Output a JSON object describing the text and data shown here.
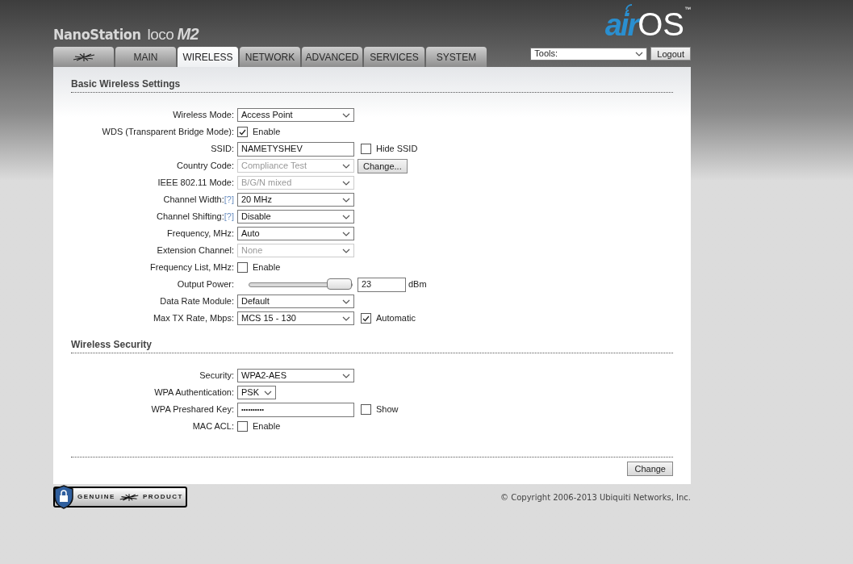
{
  "header": {
    "product_name": "NanoStation",
    "product_variant": "loco",
    "product_model": "M2",
    "logo_air": "air",
    "logo_os": "OS",
    "logo_tm": "™"
  },
  "tabs": [
    {
      "kind": "logo",
      "selected": false
    },
    {
      "kind": "text",
      "label": "MAIN",
      "selected": false
    },
    {
      "kind": "text",
      "label": "WIRELESS",
      "selected": true
    },
    {
      "kind": "text",
      "label": "NETWORK",
      "selected": false
    },
    {
      "kind": "text",
      "label": "ADVANCED",
      "selected": false
    },
    {
      "kind": "text",
      "label": "SERVICES",
      "selected": false
    },
    {
      "kind": "text",
      "label": "SYSTEM",
      "selected": false
    }
  ],
  "tools": {
    "value": "Tools:"
  },
  "logout_button": "Logout",
  "sections": [
    {
      "title": "Basic Wireless Settings",
      "fields": [
        {
          "kind": "select",
          "label": "Wireless Mode:",
          "value": "Access Point",
          "disabled": false
        },
        {
          "kind": "checkbox",
          "label": "WDS (Transparent Bridge Mode):",
          "option": "Enable",
          "checked": true
        },
        {
          "kind": "text",
          "label": "SSID:",
          "value": "NAMETYSHEV",
          "extra": {
            "kind": "checkbox",
            "label": "Hide SSID",
            "checked": false
          }
        },
        {
          "kind": "select",
          "label": "Country Code:",
          "value": "Compliance Test",
          "disabled": true,
          "extra": {
            "kind": "button",
            "label": "Change..."
          }
        },
        {
          "kind": "select",
          "label": "IEEE 802.11 Mode:",
          "value": "B/G/N mixed",
          "disabled": true
        },
        {
          "kind": "select",
          "label": "Channel Width:",
          "help": "[?]",
          "value": "20 MHz",
          "disabled": false
        },
        {
          "kind": "select",
          "label": "Channel Shifting:",
          "help": "[?]",
          "value": "Disable",
          "disabled": false
        },
        {
          "kind": "select",
          "label": "Frequency, MHz:",
          "value": "Auto",
          "disabled": false
        },
        {
          "kind": "select",
          "label": "Extension Channel:",
          "value": "None",
          "disabled": true
        },
        {
          "kind": "checkbox",
          "label": "Frequency List, MHz:",
          "option": "Enable",
          "checked": false
        },
        {
          "kind": "slider",
          "label": "Output Power:",
          "level": 1,
          "value": "23",
          "unit": "dBm"
        },
        {
          "kind": "select",
          "label": "Data Rate Module:",
          "value": "Default",
          "disabled": false
        },
        {
          "kind": "select",
          "label": "Max TX Rate, Mbps:",
          "value": "MCS 15 - 130",
          "disabled": false,
          "extra": {
            "kind": "checkbox",
            "label": "Automatic",
            "checked": true
          }
        }
      ]
    },
    {
      "title": "Wireless Security",
      "fields": [
        {
          "kind": "select",
          "label": "Security:",
          "value": "WPA2-AES",
          "disabled": false
        },
        {
          "kind": "select",
          "label": "WPA Authentication:",
          "value": "PSK",
          "disabled": false,
          "compact": true
        },
        {
          "kind": "password",
          "label": "WPA Preshared Key:",
          "value": "••••••••••",
          "extra": {
            "kind": "checkbox",
            "label": "Show",
            "checked": false
          }
        },
        {
          "kind": "checkbox",
          "label": "MAC ACL:",
          "option": "Enable",
          "checked": false
        }
      ]
    }
  ],
  "change_button": "Change",
  "badge": {
    "left": "GENUINE",
    "right": "PRODUCT"
  },
  "copyright": "© Copyright 2006-2013 Ubiquiti Networks, Inc."
}
